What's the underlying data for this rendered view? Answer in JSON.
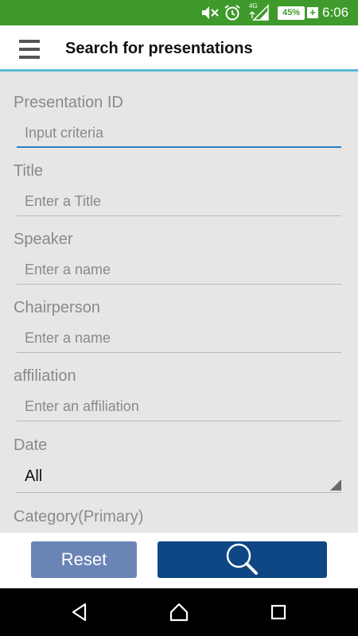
{
  "status_bar": {
    "time": "6:06",
    "battery": "45%",
    "network": "4G",
    "icons": [
      "mute-icon",
      "alarm-icon",
      "signal-icon",
      "battery-icon"
    ]
  },
  "app_bar": {
    "title": "Search for presentations",
    "menu_icon": "hamburger-menu-icon"
  },
  "form": {
    "presentation_id": {
      "label": "Presentation ID",
      "placeholder": "Input criteria",
      "value": ""
    },
    "title": {
      "label": "Title",
      "placeholder": "Enter a Title",
      "value": ""
    },
    "speaker": {
      "label": "Speaker",
      "placeholder": "Enter a name",
      "value": ""
    },
    "chairperson": {
      "label": "Chairperson",
      "placeholder": "Enter a name",
      "value": ""
    },
    "affiliation": {
      "label": "affiliation",
      "placeholder": "Enter an affiliation",
      "value": ""
    },
    "date": {
      "label": "Date",
      "selected": "All"
    },
    "category_primary": {
      "label": "Category(Primary)"
    }
  },
  "actions": {
    "reset_label": "Reset",
    "search_icon": "search-icon"
  },
  "colors": {
    "status_bar": "#3f9a2c",
    "accent_line": "#5fb8d8",
    "focus_line": "#2a7ec2",
    "reset_button": "#6a84b6",
    "search_button": "#0e4784",
    "background": "#e6e6e6"
  },
  "nav_bar": {
    "icons": [
      "back-icon",
      "home-icon",
      "recent-apps-icon"
    ]
  }
}
